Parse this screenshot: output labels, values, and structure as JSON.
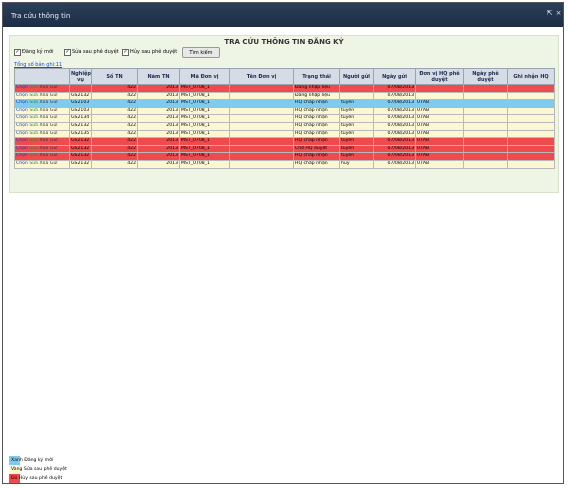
{
  "window": {
    "title": "Tra cứu thông tin"
  },
  "form": {
    "title": "TRA CỨU THÔNG TIN ĐĂNG KÝ",
    "filters": [
      {
        "label": "Đăng ký mới",
        "checked": true
      },
      {
        "label": "Sửa sau phê duyệt",
        "checked": true
      },
      {
        "label": "Hủy sau phê duyệt",
        "checked": true
      }
    ],
    "search_label": "Tìm kiếm",
    "total_label": "Tổng số bản ghi:11"
  },
  "table": {
    "headers": [
      "",
      "Nghiệp vụ",
      "Số TN",
      "Năm TN",
      "Mã Đơn vị",
      "Tên Đơn vị",
      "Trạng thái",
      "Người gửi",
      "Ngày gửi",
      "Đơn vị HQ phê duyệt",
      "Ngày phê duyệt",
      "Ghi nhận HQ"
    ],
    "action_labels": [
      "Chọn",
      "Sửa",
      "Xóa",
      "Gửi"
    ],
    "rows": [
      {
        "type": "huy",
        "nghiep_vu": "",
        "so_tn": "422",
        "nam_tn": "2013",
        "ma_dv": "MST_0708_1",
        "ten_dv": "",
        "trang_thai": "Đang nhập liệu",
        "nguoi_gui": "",
        "ngay_gui": "07/08/2013",
        "dv_hq": "",
        "ngay_pd": "",
        "ghi_nhan": ""
      },
      {
        "type": "pending",
        "nghiep_vu": "GS2132",
        "so_tn": "422",
        "nam_tn": "2013",
        "ma_dv": "MST_0708_1",
        "ten_dv": "",
        "trang_thai": "Đang nhập liệu",
        "nguoi_gui": "",
        "ngay_gui": "07/08/2013",
        "dv_hq": "",
        "ngay_pd": "",
        "ghi_nhan": ""
      },
      {
        "type": "moi",
        "nghiep_vu": "GS2103",
        "so_tn": "422",
        "nam_tn": "2013",
        "ma_dv": "MST_0708_1",
        "ten_dv": "",
        "trang_thai": "HQ chấp nhận",
        "nguoi_gui": "tuyên",
        "ngay_gui": "07/08/2013",
        "dv_hq": "07AB",
        "ngay_pd": "",
        "ghi_nhan": ""
      },
      {
        "type": "pending",
        "nghiep_vu": "GS2103",
        "so_tn": "422",
        "nam_tn": "2013",
        "ma_dv": "MST_0708_1",
        "ten_dv": "",
        "trang_thai": "HQ chấp nhận",
        "nguoi_gui": "tuyên",
        "ngay_gui": "07/08/2013",
        "dv_hq": "07AB",
        "ngay_pd": "",
        "ghi_nhan": ""
      },
      {
        "type": "pending",
        "nghiep_vu": "GS2134",
        "so_tn": "422",
        "nam_tn": "2013",
        "ma_dv": "MST_0708_1",
        "ten_dv": "",
        "trang_thai": "HQ chấp nhận",
        "nguoi_gui": "tuyên",
        "ngay_gui": "07/08/2013",
        "dv_hq": "07AB",
        "ngay_pd": "",
        "ghi_nhan": ""
      },
      {
        "type": "pending",
        "nghiep_vu": "GS2132",
        "so_tn": "422",
        "nam_tn": "2013",
        "ma_dv": "MST_0708_1",
        "ten_dv": "",
        "trang_thai": "HQ chấp nhận",
        "nguoi_gui": "tuyên",
        "ngay_gui": "07/08/2013",
        "dv_hq": "07AB",
        "ngay_pd": "",
        "ghi_nhan": ""
      },
      {
        "type": "pending",
        "nghiep_vu": "GS2135",
        "so_tn": "422",
        "nam_tn": "2013",
        "ma_dv": "MST_0708_1",
        "ten_dv": "",
        "trang_thai": "HQ chấp nhận",
        "nguoi_gui": "tuyên",
        "ngay_gui": "07/08/2013",
        "dv_hq": "07AB",
        "ngay_pd": "",
        "ghi_nhan": ""
      },
      {
        "type": "huy",
        "nghiep_vu": "GS2132",
        "so_tn": "422",
        "nam_tn": "2013",
        "ma_dv": "MST_0708_1",
        "ten_dv": "",
        "trang_thai": "HQ chấp nhận",
        "nguoi_gui": "tuyên",
        "ngay_gui": "07/08/2013",
        "dv_hq": "07AB",
        "ngay_pd": "",
        "ghi_nhan": ""
      },
      {
        "type": "huy",
        "nghiep_vu": "GS2132",
        "so_tn": "422",
        "nam_tn": "2013",
        "ma_dv": "MST_0708_1",
        "ten_dv": "",
        "trang_thai": "Chờ HQ duyệt",
        "nguoi_gui": "tuyên",
        "ngay_gui": "07/08/2013",
        "dv_hq": "07AB",
        "ngay_pd": "",
        "ghi_nhan": ""
      },
      {
        "type": "huy",
        "nghiep_vu": "GS2132",
        "so_tn": "422",
        "nam_tn": "2013",
        "ma_dv": "MST_0708_1",
        "ten_dv": "",
        "trang_thai": "HQ chấp nhận",
        "nguoi_gui": "tuyên",
        "ngay_gui": "07/08/2013",
        "dv_hq": "07AB",
        "ngay_pd": "",
        "ghi_nhan": ""
      },
      {
        "type": "pending",
        "nghiep_vu": "GS2132",
        "so_tn": "422",
        "nam_tn": "2013",
        "ma_dv": "MST_0708_1",
        "ten_dv": "",
        "trang_thai": "HQ chấp nhận",
        "nguoi_gui": "huy",
        "ngay_gui": "07/08/2013",
        "dv_hq": "07AB",
        "ngay_pd": "",
        "ghi_nhan": ""
      }
    ]
  },
  "legend": [
    {
      "swatch": "Xanh",
      "label": "Đăng ký mới",
      "color": "#7fcbf0"
    },
    {
      "swatch": "Vàng",
      "label": "Sửa sau phê duyệt",
      "color": "#fcf7d3"
    },
    {
      "swatch": "Đỏ",
      "label": "Hủy sau phê duyệt",
      "color": "#ef4a4d"
    }
  ]
}
